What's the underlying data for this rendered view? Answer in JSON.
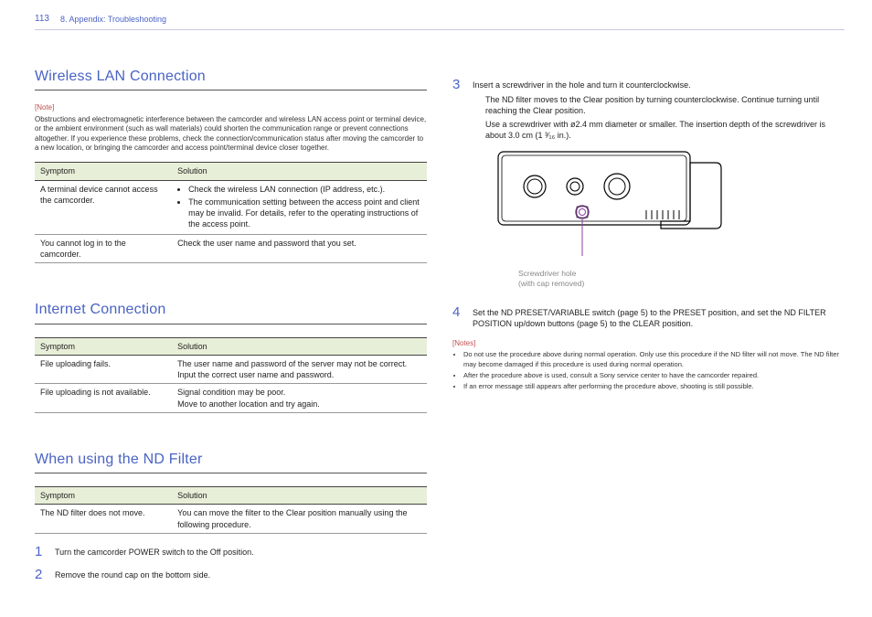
{
  "header": {
    "page_number": "113",
    "breadcrumb": "8. Appendix: Troubleshooting"
  },
  "left": {
    "section1_title": "Wireless LAN Connection",
    "section1_note_label": "[Note]",
    "section1_note": "Obstructions and electromagnetic interference between the camcorder and wireless LAN access point or terminal device, or the ambient environment (such as wall materials) could shorten the communication range or prevent connections altogether. If you experience these problems, check the connection/communication status after moving the camcorder to a new location, or bringing the camcorder and access point/terminal device closer together.",
    "th_symptom": "Symptom",
    "th_solution": "Solution",
    "t1": {
      "r1_sym": "A terminal device cannot access the camcorder.",
      "r1_sol_a": "Check the wireless LAN connection (IP address, etc.).",
      "r1_sol_b": "The communication setting between the access point and client may be invalid. For details, refer to the operating instructions of the access point.",
      "r2_sym": "You cannot log in to the camcorder.",
      "r2_sol": "Check the user name and password that you set."
    },
    "section2_title": "Internet Connection",
    "t2": {
      "r1_sym": "File uploading fails.",
      "r1_sol": "The user name and password of the server may not be correct. Input the correct user name and password.",
      "r2_sym": "File uploading is not available.",
      "r2_sol": "Signal condition may be poor.\nMove to another location and try again."
    },
    "section3_title": "When using the ND Filter",
    "t3": {
      "r1_sym": "The ND filter does not move.",
      "r1_sol": "You can move the filter to the Clear position manually using the following procedure."
    },
    "steps": {
      "s1": "Turn the camcorder POWER switch to the Off position.",
      "s2": "Remove the round cap on the bottom side."
    }
  },
  "right": {
    "s3_lead": "Insert a screwdriver in the hole and turn it counterclockwise.",
    "s3_b1": "The ND filter moves to the Clear position by turning counterclockwise. Continue turning until reaching the Clear position.",
    "s3_b2": "Use a screwdriver with ø2.4 mm diameter or smaller. The insertion depth of the screwdriver is about 3.0 cm (1 ³⁄₁₆ in.).",
    "caption_l1": "Screwdriver hole",
    "caption_l2": "(with cap removed)",
    "s4": "Set the ND PRESET/VARIABLE switch (page 5) to the PRESET position, and set the ND FILTER POSITION up/down buttons (page 5) to the CLEAR position.",
    "notes_label": "[Notes]",
    "n1": "Do not use the procedure above during normal operation. Only use this procedure if the ND filter will not move. The ND filter may become damaged if this procedure is used during normal operation.",
    "n2": "After the procedure above is used, consult a Sony service center to have the camcorder repaired.",
    "n3": "If an error message still appears after performing the procedure above, shooting is still possible."
  }
}
